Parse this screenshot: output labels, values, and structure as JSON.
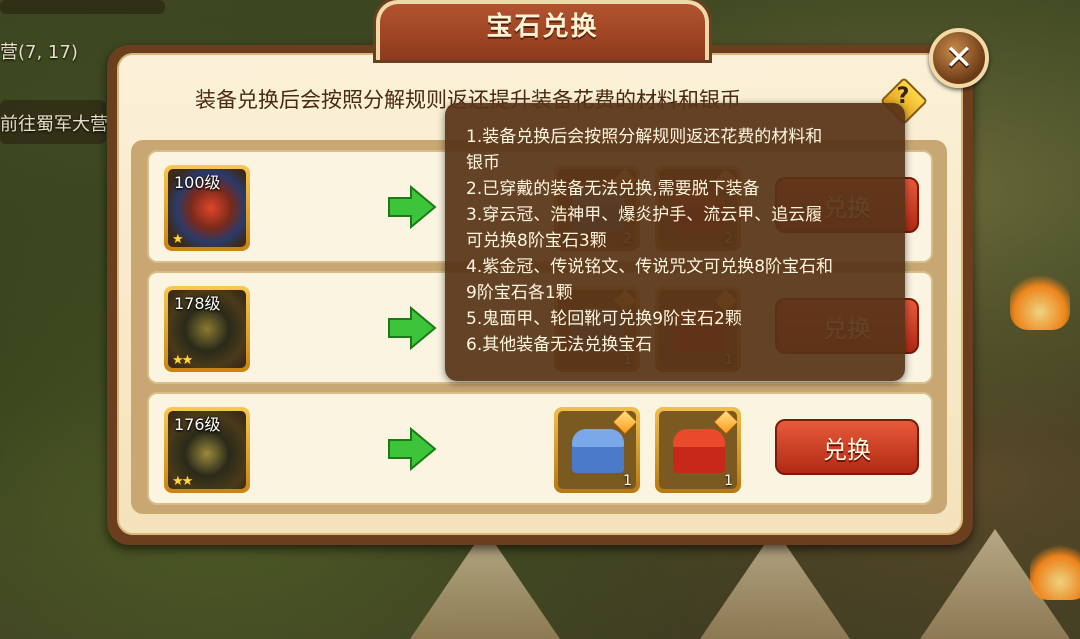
{
  "hud": {
    "coords": "营(7, 17)",
    "quest": "前往蜀军大营"
  },
  "panel": {
    "title": "宝石兑换",
    "subtitle": "装备兑换后会按照分解规则返还提升装备花费的材料和银币",
    "help_icon": "question-mark",
    "close_icon": "close-x"
  },
  "rows": [
    {
      "level": "100级",
      "stars": "★",
      "gem1_count": "2",
      "gem2_count": "2",
      "button": "兑换"
    },
    {
      "level": "178级",
      "stars": "★★",
      "gem1_count": "1",
      "gem2_count": "1",
      "button": "兑换"
    },
    {
      "level": "176级",
      "stars": "★★",
      "gem1_count": "1",
      "gem2_count": "1",
      "button": "兑换"
    }
  ],
  "tooltip": {
    "lines": [
      "1.装备兑换后会按照分解规则返还花费的材料和",
      "银币",
      "2.已穿戴的装备无法兑换,需要脱下装备",
      "3.穿云冠、浩神甲、爆炎护手、流云甲、追云履",
      "可兑换8阶宝石3颗",
      "4.紫金冠、传说铭文、传说咒文可兑换8阶宝石和",
      "9阶宝石各1颗",
      "5.鬼面甲、轮回靴可兑换9阶宝石2颗",
      "6.其他装备无法兑换宝石"
    ]
  },
  "colors": {
    "accent_button": "#c8361c",
    "panel_border": "#6b3f1e",
    "tooltip_bg": "#583418"
  }
}
